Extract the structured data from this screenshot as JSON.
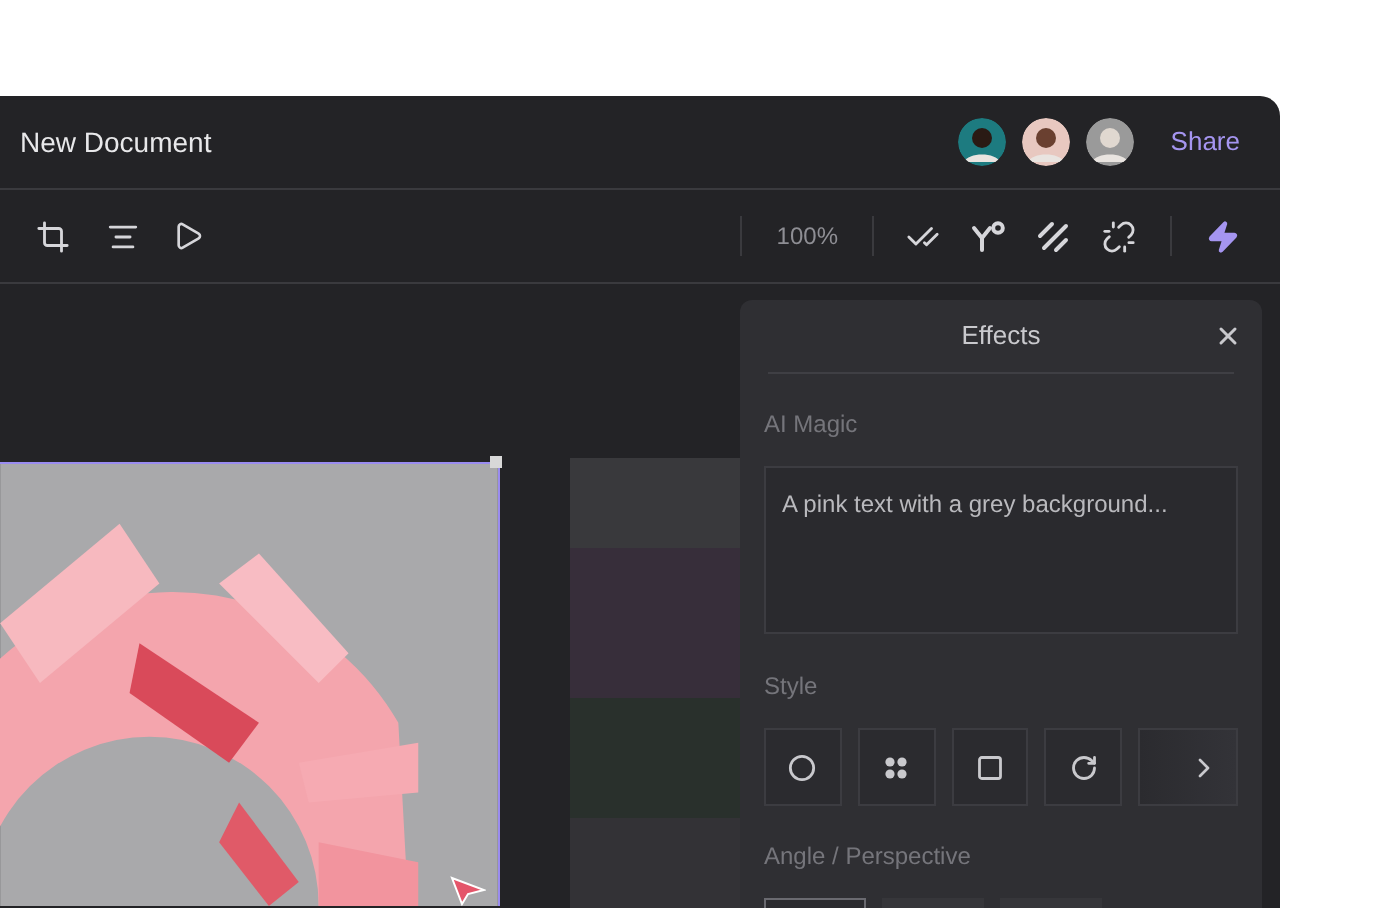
{
  "window": {
    "title": "New Document"
  },
  "share": {
    "label": "Share"
  },
  "toolbar": {
    "zoom": "100%"
  },
  "effects_panel": {
    "title": "Effects",
    "ai_magic": {
      "label": "AI Magic",
      "prompt": "A pink text with a grey background..."
    },
    "style": {
      "label": "Style",
      "options": [
        {
          "kind": "circle"
        },
        {
          "kind": "dots"
        },
        {
          "kind": "square"
        },
        {
          "kind": "rotate"
        },
        {
          "kind": "more"
        }
      ]
    },
    "angle": {
      "label": "Angle / Perspective",
      "options": [
        {
          "selected": true
        },
        {
          "selected": false
        },
        {
          "selected": false
        }
      ]
    }
  }
}
